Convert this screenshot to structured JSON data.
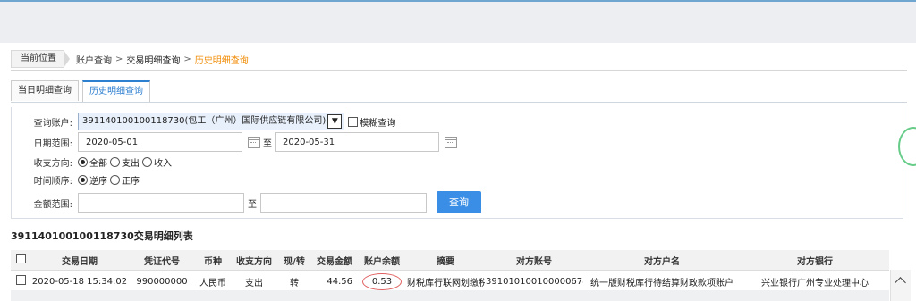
{
  "breadcrumb": {
    "here_label": "当前位置",
    "path": [
      "账户查询",
      "交易明细查询"
    ],
    "separator": ">",
    "current": "历史明细查询"
  },
  "tabs": [
    {
      "label": "当日明细查询",
      "active": false
    },
    {
      "label": "历史明细查询",
      "active": true
    }
  ],
  "form": {
    "account_label": "查询账户:",
    "account_value": "391140100100118730(包工（广州）国际供应链有限公司)",
    "fuzzy_label": "模糊查询",
    "date_label": "日期范围:",
    "date_from": "2020-05-01",
    "date_to": "2020-05-31",
    "to_label": "至",
    "direction_label": "收支方向:",
    "direction_options": [
      "全部",
      "支出",
      "收入"
    ],
    "direction_selected": "全部",
    "order_label": "时间顺序:",
    "order_options": [
      "逆序",
      "正序"
    ],
    "order_selected": "逆序",
    "amount_label": "金额范围:",
    "amount_from": "",
    "amount_to": "",
    "query_button": "查询"
  },
  "list": {
    "title": "391140100100118730交易明细列表",
    "columns": [
      "交易日期",
      "凭证代号",
      "币种",
      "收支方向",
      "现/转",
      "交易金额",
      "账户余额",
      "摘要",
      "对方账号",
      "对方户名",
      "对方银行"
    ],
    "rows": [
      [
        "2020-05-18 15:34:02",
        "990000000",
        "人民币",
        "支出",
        "转",
        "44.56",
        "0.53",
        "财税库行联网划缴税款",
        "391010100100000678",
        "统一版财税库行待结算财政款项账户",
        "兴业银行广州专业处理中心"
      ]
    ]
  },
  "colors": {
    "accent": "#3a8ee6",
    "breadcrumb_current": "#f08a00",
    "annotation_circle": "#e06060"
  }
}
